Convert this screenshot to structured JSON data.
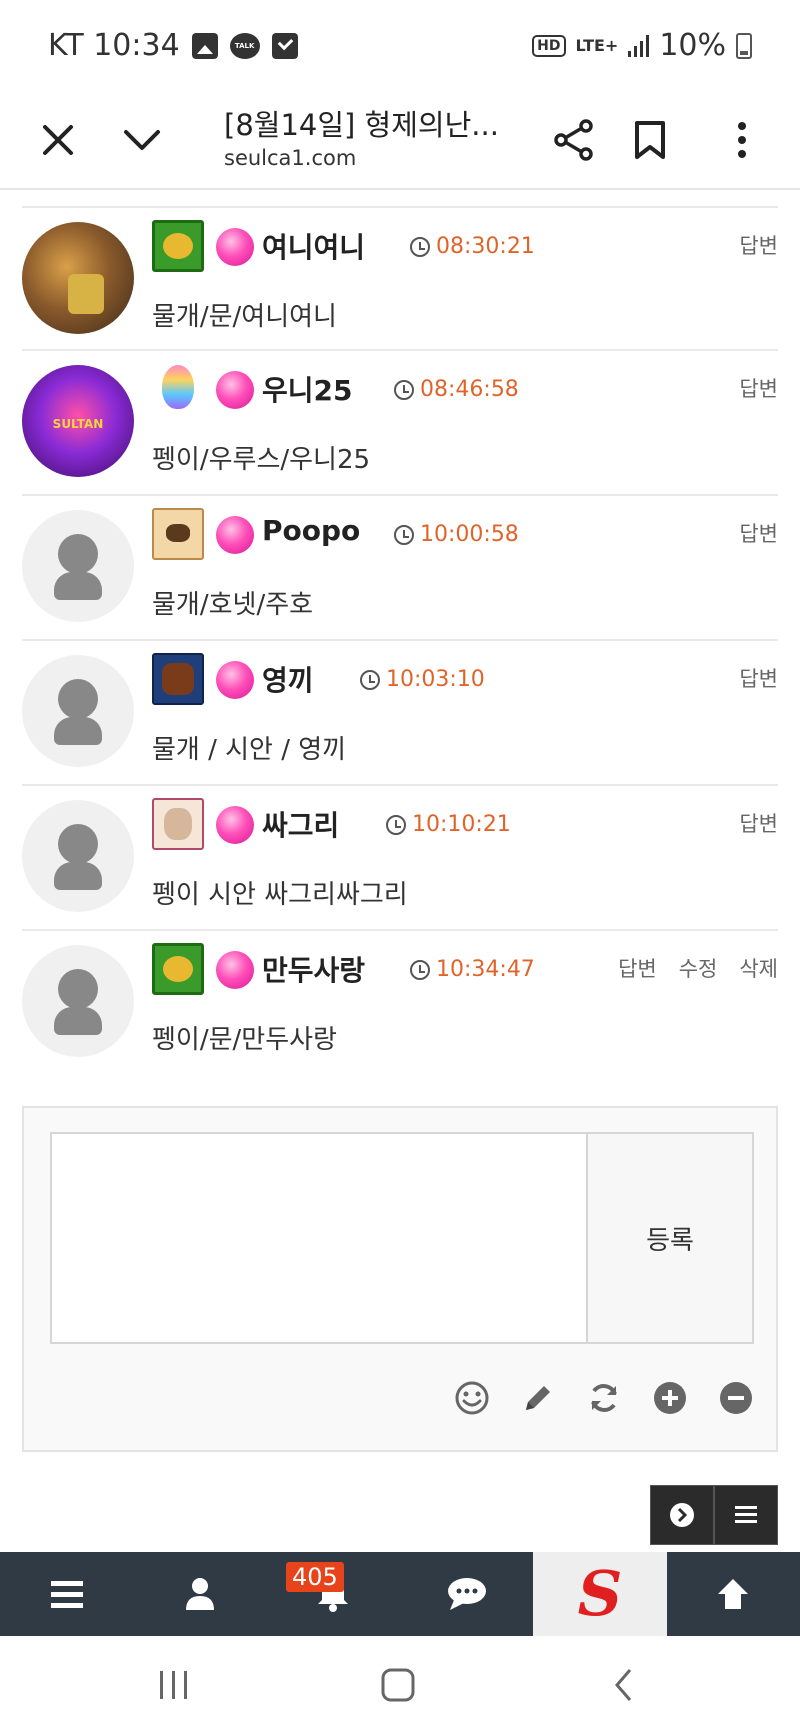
{
  "status_bar": {
    "carrier_time": "KT 10:34",
    "hd": "HD",
    "lte": "LTE+",
    "battery": "10%"
  },
  "browser": {
    "title": "[8월14일] 형제의난...",
    "url": "seulca1.com"
  },
  "comments": [
    {
      "nick": "여니여니",
      "time": "08:30:21",
      "text": "물개/문/여니여니",
      "actions": [
        "답변"
      ]
    },
    {
      "nick": "우니25",
      "time": "08:46:58",
      "text": "펭이/우루스/우니25",
      "actions": [
        "답변"
      ]
    },
    {
      "nick": "Poopo",
      "time": "10:00:58",
      "text": "물개/호넷/주호",
      "actions": [
        "답변"
      ]
    },
    {
      "nick": "영끼",
      "time": "10:03:10",
      "text": "물개 / 시안 / 영끼",
      "actions": [
        "답변"
      ]
    },
    {
      "nick": "싸그리",
      "time": "10:10:21",
      "text": "펭이 시안 싸그리싸그리",
      "actions": [
        "답변"
      ]
    },
    {
      "nick": "만두사랑",
      "time": "10:34:47",
      "text": "펭이/문/만두사랑",
      "actions": [
        "답변",
        "수정",
        "삭제"
      ]
    }
  ],
  "reply_form": {
    "textarea_value": "",
    "submit_label": "등록"
  },
  "bottom_bar": {
    "notification_count": "405",
    "logo_letter": "S"
  },
  "colors": {
    "time": "#e0642a",
    "bar_bg": "#2f3a45",
    "badge": "#e8441c"
  }
}
